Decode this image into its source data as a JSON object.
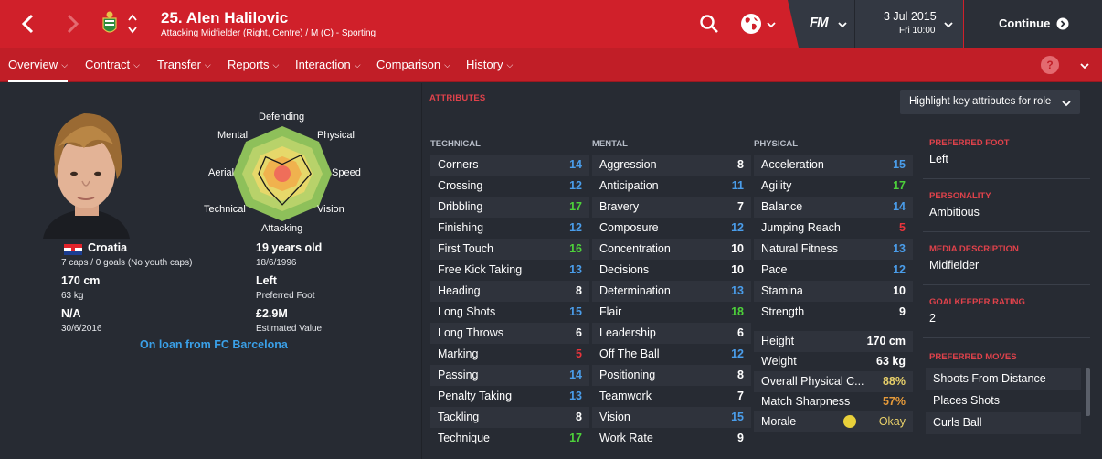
{
  "header": {
    "title": "25. Alen Halilovic",
    "subtitle": "Attacking Midfielder (Right, Centre) / M (C) - Sporting",
    "date": "3 Jul 2015",
    "time": "Fri 10:00",
    "fm_logo": "FM",
    "continue_label": "Continue",
    "icons": [
      "back-icon",
      "forward-icon",
      "club-crest-icon",
      "up-down-icon",
      "search-icon",
      "globe-icon",
      "chevron-down-icon"
    ]
  },
  "tabs": [
    {
      "label": "Overview",
      "active": true
    },
    {
      "label": "Contract"
    },
    {
      "label": "Transfer"
    },
    {
      "label": "Reports"
    },
    {
      "label": "Interaction"
    },
    {
      "label": "Comparison"
    },
    {
      "label": "History"
    }
  ],
  "help_icon": "?",
  "profile": {
    "nation": "Croatia",
    "caps": "7 caps / 0 goals (No youth caps)",
    "height": "170 cm",
    "weight": "63 kg",
    "contract_status": "N/A",
    "contract_date": "30/6/2016",
    "age": "19 years old",
    "dob": "18/6/1996",
    "foot": "Left",
    "foot_label": "Preferred Foot",
    "value": "£2.9M",
    "value_label": "Estimated Value",
    "loan": "On loan from FC Barcelona"
  },
  "radar": {
    "labels": [
      "Defending",
      "Physical",
      "Speed",
      "Vision",
      "Attacking",
      "Technical",
      "Aerial",
      "Mental"
    ],
    "values": [
      0.2,
      0.55,
      0.6,
      0.45,
      0.65,
      0.45,
      0.5,
      0.5
    ]
  },
  "attributes": {
    "section_label": "ATTRIBUTES",
    "highlight_dropdown": "Highlight key attributes for role",
    "technical_header": "TECHNICAL",
    "mental_header": "MENTAL",
    "physical_header": "PHYSICAL",
    "technical": [
      {
        "name": "Corners",
        "value": "14",
        "color": "blue"
      },
      {
        "name": "Crossing",
        "value": "12",
        "color": "blue"
      },
      {
        "name": "Dribbling",
        "value": "17",
        "color": "green"
      },
      {
        "name": "Finishing",
        "value": "12",
        "color": "blue"
      },
      {
        "name": "First Touch",
        "value": "16",
        "color": "green"
      },
      {
        "name": "Free Kick Taking",
        "value": "13",
        "color": "blue"
      },
      {
        "name": "Heading",
        "value": "8",
        "color": "white"
      },
      {
        "name": "Long Shots",
        "value": "15",
        "color": "blue"
      },
      {
        "name": "Long Throws",
        "value": "6",
        "color": "white"
      },
      {
        "name": "Marking",
        "value": "5",
        "color": "red"
      },
      {
        "name": "Passing",
        "value": "14",
        "color": "blue"
      },
      {
        "name": "Penalty Taking",
        "value": "13",
        "color": "blue"
      },
      {
        "name": "Tackling",
        "value": "8",
        "color": "white"
      },
      {
        "name": "Technique",
        "value": "17",
        "color": "green"
      }
    ],
    "mental": [
      {
        "name": "Aggression",
        "value": "8",
        "color": "white"
      },
      {
        "name": "Anticipation",
        "value": "11",
        "color": "blue"
      },
      {
        "name": "Bravery",
        "value": "7",
        "color": "white"
      },
      {
        "name": "Composure",
        "value": "12",
        "color": "blue"
      },
      {
        "name": "Concentration",
        "value": "10",
        "color": "white"
      },
      {
        "name": "Decisions",
        "value": "10",
        "color": "white"
      },
      {
        "name": "Determination",
        "value": "13",
        "color": "blue"
      },
      {
        "name": "Flair",
        "value": "18",
        "color": "green"
      },
      {
        "name": "Leadership",
        "value": "6",
        "color": "white"
      },
      {
        "name": "Off The Ball",
        "value": "12",
        "color": "blue"
      },
      {
        "name": "Positioning",
        "value": "8",
        "color": "white"
      },
      {
        "name": "Teamwork",
        "value": "7",
        "color": "white"
      },
      {
        "name": "Vision",
        "value": "15",
        "color": "blue"
      },
      {
        "name": "Work Rate",
        "value": "9",
        "color": "white"
      }
    ],
    "physical": [
      {
        "name": "Acceleration",
        "value": "15",
        "color": "blue"
      },
      {
        "name": "Agility",
        "value": "17",
        "color": "green"
      },
      {
        "name": "Balance",
        "value": "14",
        "color": "blue"
      },
      {
        "name": "Jumping Reach",
        "value": "5",
        "color": "red"
      },
      {
        "name": "Natural Fitness",
        "value": "13",
        "color": "blue"
      },
      {
        "name": "Pace",
        "value": "12",
        "color": "blue"
      },
      {
        "name": "Stamina",
        "value": "10",
        "color": "white"
      },
      {
        "name": "Strength",
        "value": "9",
        "color": "white"
      }
    ],
    "physical_info": [
      {
        "name": "Height",
        "value": "170 cm",
        "color": "white"
      },
      {
        "name": "Weight",
        "value": "63 kg",
        "color": "white"
      },
      {
        "name": "Overall Physical C...",
        "value": "88%",
        "color": "yellow"
      },
      {
        "name": "Match Sharpness",
        "value": "57%",
        "color": "orange"
      },
      {
        "name": "Morale",
        "value": "Okay",
        "color": "yellow"
      }
    ]
  },
  "right_panel": {
    "preferred_foot_label": "PREFERRED FOOT",
    "preferred_foot": "Left",
    "personality_label": "PERSONALITY",
    "personality": "Ambitious",
    "media_label": "MEDIA DESCRIPTION",
    "media": "Midfielder",
    "gk_label": "GOALKEEPER RATING",
    "gk": "2",
    "moves_label": "PREFERRED MOVES",
    "moves": [
      "Shoots From Distance",
      "Places Shots",
      "Curls Ball"
    ]
  },
  "colors": {
    "brand_red": "#d0202a",
    "background": "#272b33",
    "blue": "#4a9dea",
    "green": "#4dd13a",
    "red": "#e8343c",
    "link": "#3aa0e8"
  }
}
